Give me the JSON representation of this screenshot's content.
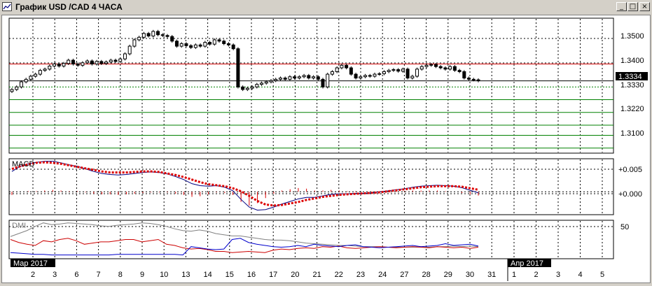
{
  "window": {
    "title": "График USD /CAD  4 ЧАСА",
    "minimize_glyph": "_",
    "maximize_glyph": "□",
    "close_glyph": "×"
  },
  "icons": {
    "app": "chart-app-icon",
    "minimize": "minimize-icon",
    "maximize": "maximize-icon",
    "close": "close-icon"
  },
  "colors": {
    "up_candle": "#000000",
    "resistance": "#cc0000",
    "support": "#008000",
    "macd_line": "#000080",
    "signal_line": "#dd0000",
    "dmi_plus": "#0000cc",
    "dmi_minus": "#cc0000",
    "adx": "#808080"
  },
  "price_axis": {
    "labels": [
      "1.3500",
      "1.3400",
      "1.3330",
      "1.3220",
      "1.3100"
    ],
    "current_price": "1.3334"
  },
  "macd_panel": {
    "label": "MACD",
    "axis_labels": [
      "+0.005",
      "+0.000"
    ]
  },
  "dmi_panel": {
    "label": "DMI",
    "axis_labels": [
      "50"
    ]
  },
  "time_axis": {
    "month_labels": [
      "Мар 2017",
      "Апр 2017"
    ],
    "march_days": [
      "2",
      "3",
      "6",
      "7",
      "8",
      "9",
      "10",
      "13",
      "14",
      "15",
      "16",
      "17",
      "20",
      "21",
      "22",
      "23",
      "24",
      "27",
      "28",
      "29",
      "30",
      "31"
    ],
    "april_days": [
      "1",
      "2",
      "3",
      "4",
      "5"
    ]
  },
  "chart_data": [
    {
      "type": "candlestick",
      "title": "График USD /CAD  4 ЧАСА",
      "ylim": [
        1.305,
        1.358
      ],
      "current_price": 1.3334,
      "horizontal_lines": [
        1.34,
        1.3334,
        1.331,
        1.326,
        1.321,
        1.316,
        1.312,
        1.307
      ],
      "close": [
        1.33,
        1.331,
        1.333,
        1.334,
        1.3352,
        1.336,
        1.3375,
        1.338,
        1.3392,
        1.34,
        1.3392,
        1.3402,
        1.3415,
        1.34,
        1.3395,
        1.3405,
        1.3412,
        1.34,
        1.341,
        1.3402,
        1.3408,
        1.3415,
        1.341,
        1.342,
        1.344,
        1.347,
        1.3495,
        1.3505,
        1.352,
        1.351,
        1.3528,
        1.3515,
        1.3512,
        1.3508,
        1.349,
        1.347,
        1.348,
        1.3472,
        1.3465,
        1.3475,
        1.347,
        1.3485,
        1.3478,
        1.3495,
        1.349,
        1.348,
        1.3475,
        1.346,
        1.331,
        1.33,
        1.3305,
        1.331,
        1.332,
        1.3325,
        1.333,
        1.3335,
        1.334,
        1.3345,
        1.334,
        1.335,
        1.3345,
        1.335,
        1.3355,
        1.3345,
        1.335,
        1.334,
        1.331,
        1.336,
        1.337,
        1.3385,
        1.3395,
        1.3385,
        1.336,
        1.3345,
        1.335,
        1.3355,
        1.3352,
        1.336,
        1.3362,
        1.337,
        1.3375,
        1.3378,
        1.3372,
        1.338,
        1.3345,
        1.3352,
        1.338,
        1.339,
        1.3395,
        1.3398,
        1.339,
        1.3385,
        1.338,
        1.339,
        1.3375,
        1.337,
        1.3345,
        1.334,
        1.3338,
        1.3334
      ],
      "macd": [
        0.004,
        0.005,
        0.0055,
        0.0058,
        0.006,
        0.006,
        0.0057,
        0.0053,
        0.005,
        0.0045,
        0.004,
        0.0036,
        0.0034,
        0.0033,
        0.0034,
        0.0036,
        0.0038,
        0.0039,
        0.0038,
        0.0035,
        0.003,
        0.0024,
        0.0016,
        0.0012,
        0.0011,
        0.0012,
        0.0009,
        0.0002,
        -0.0015,
        -0.003,
        -0.0036,
        -0.0035,
        -0.003,
        -0.0024,
        -0.0019,
        -0.0014,
        -0.0011,
        -0.0011,
        -0.0008,
        -0.0005,
        -0.0004,
        -0.0004,
        -0.0003,
        -0.0003,
        -0.0002,
        0.0,
        0.0002,
        0.0004,
        0.0006,
        0.0009,
        0.0011,
        0.0012,
        0.0013,
        0.0012,
        0.0011,
        0.0008,
        0.0003,
        -0.0002
      ],
      "signal": [
        0.0045,
        0.005,
        0.0054,
        0.0057,
        0.0058,
        0.0057,
        0.0055,
        0.0052,
        0.0049,
        0.0046,
        0.0043,
        0.004,
        0.0038,
        0.0038,
        0.0038,
        0.0039,
        0.004,
        0.004,
        0.0039,
        0.0036,
        0.0033,
        0.0029,
        0.0024,
        0.0019,
        0.0015,
        0.0013,
        0.0011,
        0.0007,
        0.0001,
        -0.0008,
        -0.0018,
        -0.0025,
        -0.0027,
        -0.0026,
        -0.0023,
        -0.002,
        -0.0016,
        -0.0013,
        -0.001,
        -0.0008,
        -0.0006,
        -0.0005,
        -0.0004,
        -0.0003,
        -0.0002,
        -0.0001,
        0.0001,
        0.0003,
        0.0005,
        0.0007,
        0.0009,
        0.001,
        0.0011,
        0.0011,
        0.0011,
        0.001,
        0.0007,
        0.0004
      ],
      "dmi_plus": [
        8,
        7,
        6,
        5,
        5,
        4,
        4,
        4,
        4,
        4,
        4,
        4,
        4,
        5,
        5,
        5,
        5,
        5,
        5,
        5,
        5,
        4,
        18,
        16,
        14,
        13,
        14,
        30,
        32,
        25,
        22,
        20,
        18,
        17,
        18,
        20,
        18,
        22,
        20,
        19,
        18,
        20,
        21,
        18,
        17,
        16,
        17,
        18,
        19,
        20,
        18,
        19,
        20,
        23,
        20,
        21,
        22,
        19
      ],
      "dmi_minus": [
        30,
        25,
        22,
        20,
        28,
        26,
        30,
        32,
        28,
        22,
        24,
        26,
        26,
        28,
        30,
        30,
        26,
        28,
        30,
        22,
        20,
        16,
        14,
        15,
        13,
        10,
        10,
        8,
        9,
        10,
        9,
        8,
        12,
        14,
        13,
        15,
        16,
        15,
        18,
        17,
        19,
        16,
        15,
        16,
        17,
        18,
        17,
        16,
        17,
        18,
        17,
        16,
        18,
        17,
        16,
        17,
        15,
        17
      ],
      "adx": [
        35,
        40,
        45,
        52,
        58,
        55,
        56,
        58,
        57,
        56,
        55,
        53,
        52,
        54,
        55,
        56,
        58,
        57,
        55,
        52,
        48,
        45,
        44,
        46,
        44,
        40,
        38,
        36,
        36,
        34,
        32,
        30,
        29,
        29,
        28,
        26,
        24,
        23,
        22,
        21,
        20,
        20,
        19,
        18,
        18,
        18,
        17,
        17,
        17,
        17,
        17,
        17,
        18,
        18,
        19,
        18,
        19,
        18
      ]
    }
  ]
}
